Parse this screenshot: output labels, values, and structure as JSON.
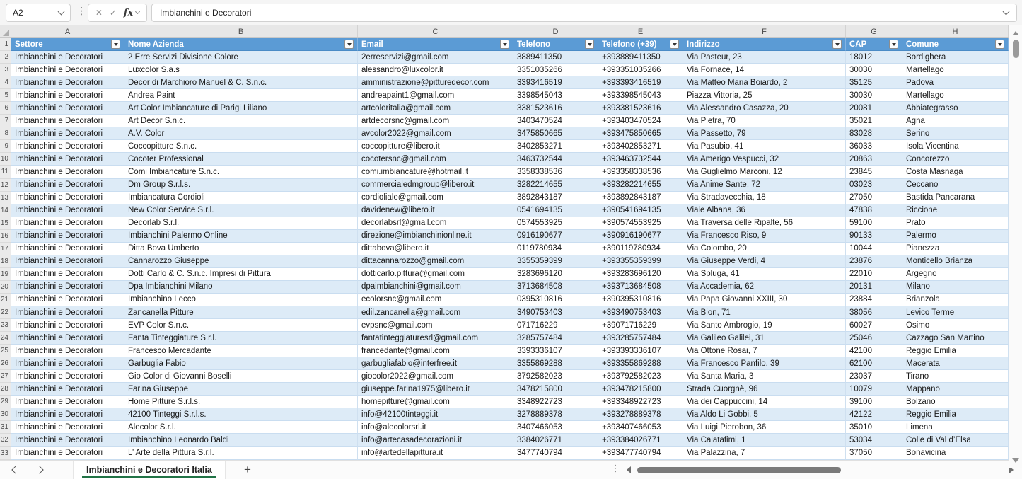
{
  "formula_bar": {
    "cell_reference": "A2",
    "formula_value": "Imbianchini e Decoratori"
  },
  "column_letters": [
    "A",
    "B",
    "C",
    "D",
    "E",
    "F",
    "G",
    "H"
  ],
  "table": {
    "headers": [
      "Settore",
      "Nome Azienda",
      "Email",
      "Telefono",
      "Telefono (+39)",
      "Indirizzo",
      "CAP",
      "Comune"
    ],
    "first_row_number": 2,
    "rows": [
      [
        "Imbianchini e Decoratori",
        "2 Erre Servizi Divisione Colore",
        "2erreservizi@gmail.com",
        "3889411350",
        "+393889411350",
        "Via Pasteur, 23",
        "18012",
        "Bordighera"
      ],
      [
        "Imbianchini e Decoratori",
        "Luxcolor S.a.s",
        "alessandro@luxcolor.it",
        "3351035266",
        "+393351035266",
        "Via Fornace, 14",
        "30030",
        "Martellago"
      ],
      [
        "Imbianchini e Decoratori",
        "Decor di Marchioro Manuel & C. S.n.c.",
        "amministrazione@pitturedecor.com",
        "3393416519",
        "+393393416519",
        "Via Matteo Maria Boiardo, 2",
        "35125",
        "Padova"
      ],
      [
        "Imbianchini e Decoratori",
        "Andrea Paint",
        "andreapaint1@gmail.com",
        "3398545043",
        "+393398545043",
        "Piazza Vittoria, 25",
        "30030",
        "Martellago"
      ],
      [
        "Imbianchini e Decoratori",
        "Art Color Imbiancature di Parigi Liliano",
        "artcoloritalia@gmail.com",
        "3381523616",
        "+393381523616",
        "Via Alessandro Casazza, 20",
        "20081",
        "Abbiategrasso"
      ],
      [
        "Imbianchini e Decoratori",
        "Art Decor S.n.c.",
        "artdecorsnc@gmail.com",
        "3403470524",
        "+393403470524",
        "Via Pietra, 70",
        "35021",
        "Agna"
      ],
      [
        "Imbianchini e Decoratori",
        "A.V. Color",
        "avcolor2022@gmail.com",
        "3475850665",
        "+393475850665",
        "Via Passetto, 79",
        "83028",
        "Serino"
      ],
      [
        "Imbianchini e Decoratori",
        "Coccopitture S.n.c.",
        "coccopitture@libero.it",
        "3402853271",
        "+393402853271",
        "Via Pasubio, 41",
        "36033",
        "Isola Vicentina"
      ],
      [
        "Imbianchini e Decoratori",
        "Cocoter Professional",
        "cocotersnc@gmail.com",
        "3463732544",
        "+393463732544",
        "Via Amerigo Vespucci, 32",
        "20863",
        "Concorezzo"
      ],
      [
        "Imbianchini e Decoratori",
        "Comi Imbiancature S.n.c.",
        "comi.imbiancature@hotmail.it",
        "3358338536",
        "+393358338536",
        "Via Guglielmo Marconi, 12",
        "23845",
        "Costa Masnaga"
      ],
      [
        "Imbianchini e Decoratori",
        "Dm Group S.r.l.s.",
        "commercialedmgroup@libero.it",
        "3282214655",
        "+393282214655",
        "Via Anime Sante, 72",
        "03023",
        "Ceccano"
      ],
      [
        "Imbianchini e Decoratori",
        "Imbiancatura Cordioli",
        "cordioliale@gmail.com",
        "3892843187",
        "+393892843187",
        "Via Stradavecchia, 18",
        "27050",
        "Bastida Pancarana"
      ],
      [
        "Imbianchini e Decoratori",
        "New Color Service S.r.l.",
        "davidenew@libero.it",
        "0541694135",
        "+390541694135",
        "Viale Albana, 36",
        "47838",
        "Riccione"
      ],
      [
        "Imbianchini e Decoratori",
        "Decorlab S.r.l.",
        "decorlabsrl@gmail.com",
        "0574553925",
        "+390574553925",
        "Via Traversa delle Ripalte, 56",
        "59100",
        "Prato"
      ],
      [
        "Imbianchini e Decoratori",
        "Imbianchini Palermo Online",
        "direzione@imbianchinionline.it",
        "0916190677",
        "+390916190677",
        "Via Francesco Riso, 9",
        "90133",
        "Palermo"
      ],
      [
        "Imbianchini e Decoratori",
        "Ditta Bova Umberto",
        "dittabova@libero.it",
        "0119780934",
        "+390119780934",
        "Via Colombo, 20",
        "10044",
        "Pianezza"
      ],
      [
        "Imbianchini e Decoratori",
        "Cannarozzo Giuseppe",
        "dittacannarozzo@gmail.com",
        "3355359399",
        "+393355359399",
        "Via Giuseppe Verdi, 4",
        "23876",
        "Monticello Brianza"
      ],
      [
        "Imbianchini e Decoratori",
        "Dotti Carlo & C. S.n.c. Impresi di Pittura",
        "dotticarlo.pittura@gmail.com",
        "3283696120",
        "+393283696120",
        "Via Spluga, 41",
        "22010",
        "Argegno"
      ],
      [
        "Imbianchini e Decoratori",
        "Dpa Imbianchini Milano",
        "dpaimbianchini@gmail.com",
        "3713684508",
        "+393713684508",
        "Via Accademia, 62",
        "20131",
        "Milano"
      ],
      [
        "Imbianchini e Decoratori",
        "Imbianchino Lecco",
        "ecolorsnc@gmail.com",
        "0395310816",
        "+390395310816",
        "Via Papa Giovanni XXIII, 30",
        "23884",
        "Brianzola"
      ],
      [
        "Imbianchini e Decoratori",
        "Zancanella Pitture",
        "edil.zancanella@gmail.com",
        "3490753403",
        "+393490753403",
        "Via Bion, 71",
        "38056",
        "Levico Terme"
      ],
      [
        "Imbianchini e Decoratori",
        "EVP Color S.n.c.",
        "evpsnc@gmail.com",
        "071716229",
        "+39071716229",
        "Via Santo Ambrogio, 19",
        "60027",
        "Osimo"
      ],
      [
        "Imbianchini e Decoratori",
        "Fanta Tinteggiature S.r.l.",
        "fantatinteggiaturesrl@gmail.com",
        "3285757484",
        "+393285757484",
        "Via Galileo Galilei, 31",
        "25046",
        "Cazzago San Martino"
      ],
      [
        "Imbianchini e Decoratori",
        "Francesco Mercadante",
        "francedante@gmail.com",
        "3393336107",
        "+393393336107",
        "Via Ottone Rosai, 7",
        "42100",
        "Reggio Emilia"
      ],
      [
        "Imbianchini e Decoratori",
        "Garbuglia Fabio",
        "garbugliafabio@interfree.it",
        "3355869288",
        "+393355869288",
        "Via Francesco Panfilo, 39",
        "62100",
        "Macerata"
      ],
      [
        "Imbianchini e Decoratori",
        "Gio Color di Giovanni Boselli",
        "giocolor2022@gmail.com",
        "3792582023",
        "+393792582023",
        "Via Santa Maria, 3",
        "23037",
        "Tirano"
      ],
      [
        "Imbianchini e Decoratori",
        "Farina Giuseppe",
        "giuseppe.farina1975@libero.it",
        "3478215800",
        "+393478215800",
        "Strada Cuorgnè, 96",
        "10079",
        "Mappano"
      ],
      [
        "Imbianchini e Decoratori",
        "Home Pitture S.r.l.s.",
        "homepitture@gmail.com",
        "3348922723",
        "+393348922723",
        "Via dei Cappuccini, 14",
        "39100",
        "Bolzano"
      ],
      [
        "Imbianchini e Decoratori",
        "42100 Tinteggi S.r.l.s.",
        "info@42100tinteggi.it",
        "3278889378",
        "+393278889378",
        "Via Aldo Li Gobbi, 5",
        "42122",
        "Reggio Emilia"
      ],
      [
        "Imbianchini e Decoratori",
        "Alecolor S.r.l.",
        "info@alecolorsrl.it",
        "3407466053",
        "+393407466053",
        "Via Luigi Pierobon, 36",
        "35010",
        "Limena"
      ],
      [
        "Imbianchini e Decoratori",
        "Imbianchino Leonardo Baldi",
        "info@artecasadecorazioni.it",
        "3384026771",
        "+393384026771",
        "Via Calatafimi, 1",
        "53034",
        "Colle di Val d’Elsa"
      ],
      [
        "Imbianchini e Decoratori",
        "L’ Arte della Pittura S.r.l.",
        "info@artedellapittura.it",
        "3477740794",
        "+393477740794",
        "Via Palazzina, 7",
        "37050",
        "Bonavicina"
      ]
    ]
  },
  "sheet_bar": {
    "active_tab": "Imbianchini e Decoratori Italia",
    "add_label": "+"
  },
  "colors": {
    "header_bg": "#5B9BD5",
    "banded_row": "#DDEBF7",
    "tab_underline": "#217346"
  }
}
